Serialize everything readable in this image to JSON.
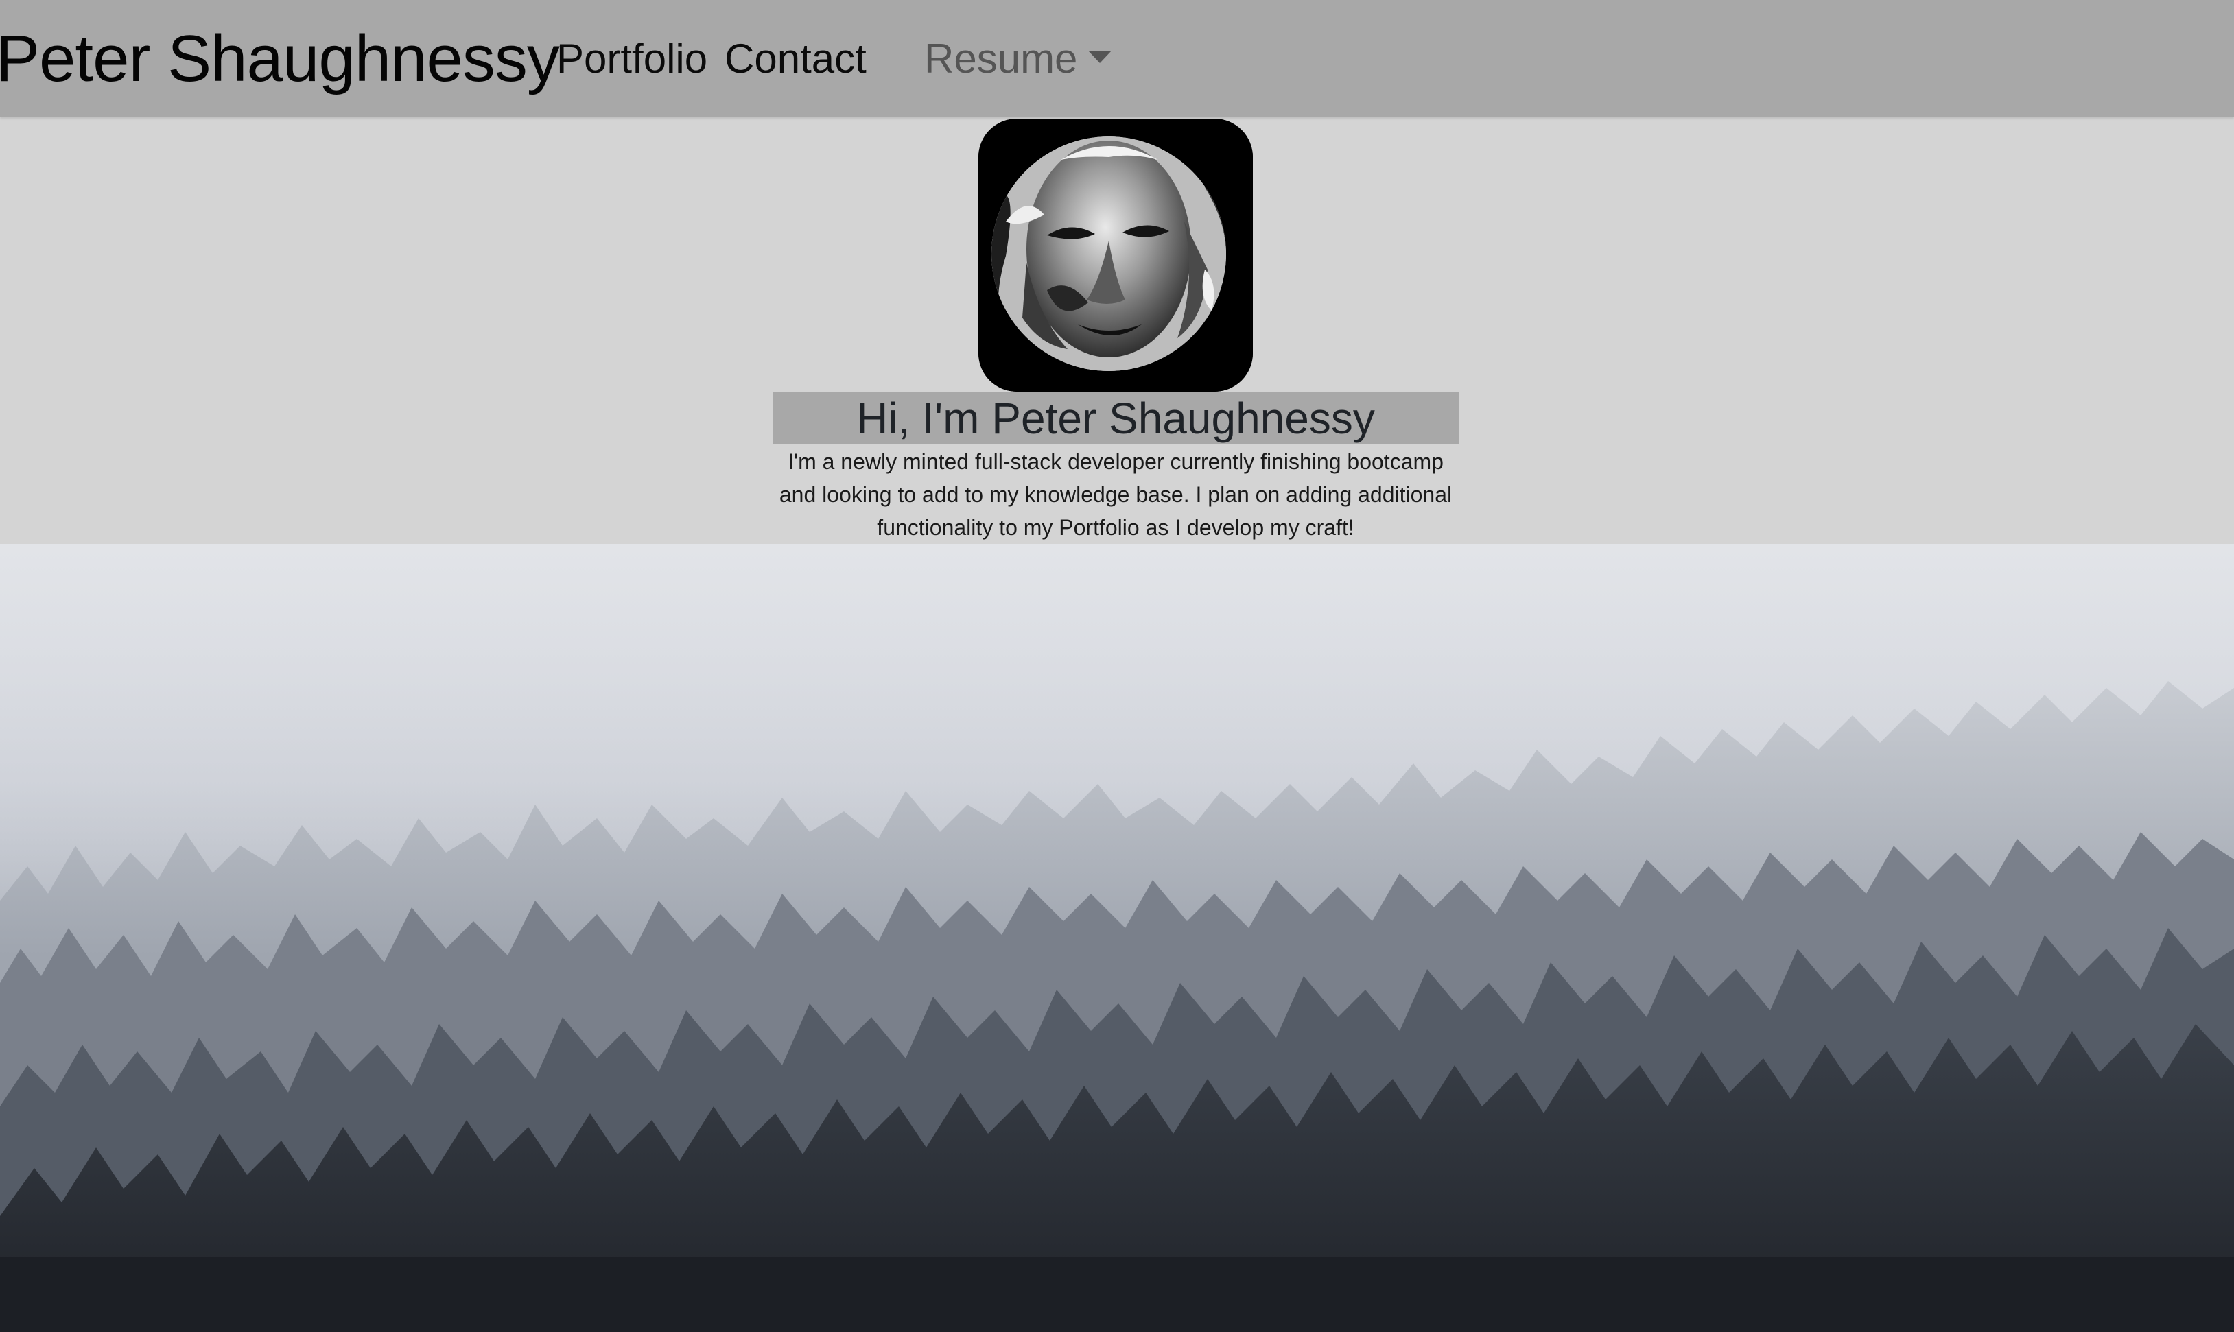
{
  "navbar": {
    "brand": "Peter Shaughnessy",
    "links": [
      {
        "label": "Portfolio"
      },
      {
        "label": "Contact"
      }
    ],
    "dropdown": {
      "label": "Resume",
      "icon": "caret-down-icon"
    }
  },
  "hero": {
    "heading": "Hi, I'm Peter Shaughnessy",
    "intro_lines": [
      "I'm a newly minted full-stack developer currently finishing bootcamp",
      "and looking to add to my knowledge base. I plan on adding additional",
      "functionality to my Portfolio as I develop my craft!"
    ]
  },
  "colors": {
    "navbar_bg": "#a8a8a8",
    "page_bg": "#d4d4d4",
    "heading_highlight": "#a8a8a8",
    "avatar_frame": "#000000"
  }
}
